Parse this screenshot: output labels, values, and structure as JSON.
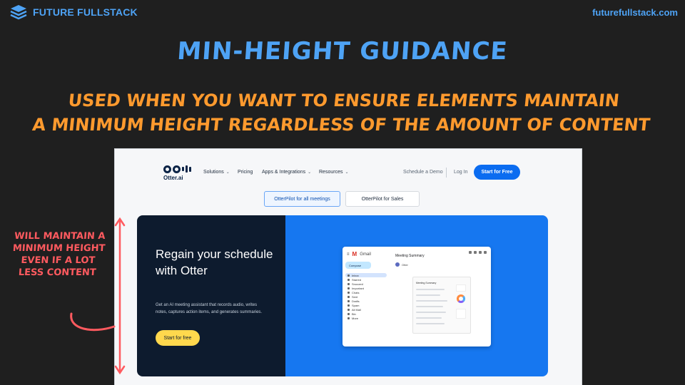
{
  "brand": {
    "name": "FUTURE FULLSTACK",
    "site": "futurefullstack.com"
  },
  "slide": {
    "title": "MIN-HEIGHT GUIDANCE",
    "subtitle_line1": "USED WHEN YOU WANT TO ENSURE ELEMENTS MAINTAIN",
    "subtitle_line2": "A MINIMUM HEIGHT REGARDLESS OF THE AMOUNT OF CONTENT",
    "side_note": "WILL MAINTAIN A MINIMUM HEIGHT EVEN IF A LOT LESS CONTENT"
  },
  "colors": {
    "accent_blue": "#4ea3f5",
    "accent_orange": "#ff9a2e",
    "note_red": "#ff5a5f",
    "otter_blue": "#1677f0",
    "otter_navy": "#0d1b2e",
    "cta_yellow": "#ffd84d"
  },
  "otter": {
    "logo_text": "Otter.ai",
    "nav": {
      "solutions": "Solutions",
      "pricing": "Pricing",
      "apps": "Apps & Integrations",
      "resources": "Resources",
      "demo": "Schedule a Demo",
      "login": "Log In",
      "start": "Start for Free"
    },
    "tabs": {
      "meetings": "OtterPilot for all meetings",
      "sales": "OtterPilot for Sales"
    },
    "hero": {
      "heading": "Regain your schedule with Otter",
      "body": "Get an AI meeting assistant that records audio, writes notes, captures action items, and generates summaries.",
      "cta": "Start for free"
    },
    "gmail": {
      "app": "Gmail",
      "compose": "Compose",
      "folders": [
        "Inbox",
        "Starred",
        "Snoozed",
        "Important",
        "Chats",
        "Sent",
        "Drafts",
        "Spam",
        "All Mail",
        "Bin",
        "More"
      ],
      "subject": "Meeting Summary",
      "from": "Otter",
      "card_title": "Meeting Summary"
    }
  }
}
